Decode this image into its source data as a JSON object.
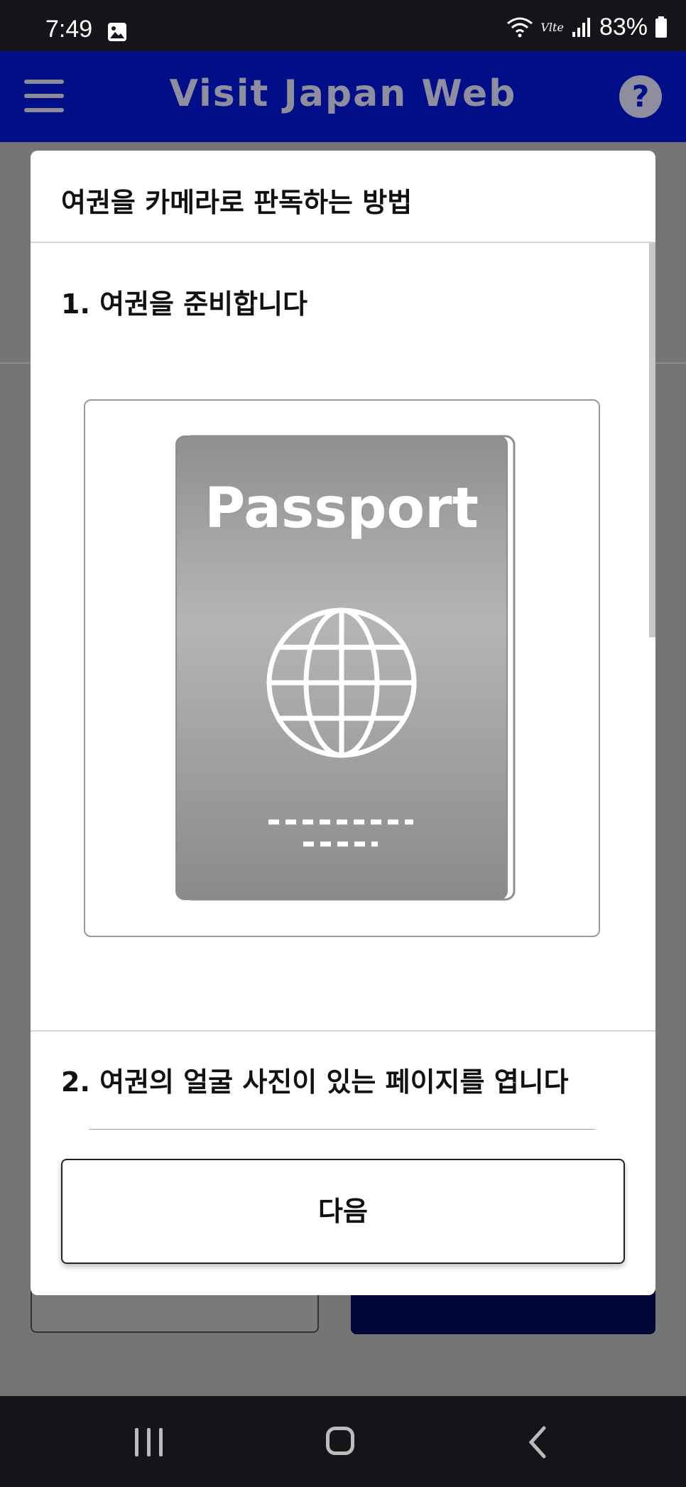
{
  "status_bar": {
    "time": "7:49",
    "battery": "83%",
    "network": "Vlte"
  },
  "app_bar": {
    "title": "Visit Japan Web",
    "help": "?"
  },
  "modal": {
    "title": "여권을 카메라로 판독하는 방법",
    "steps": [
      {
        "label": "1. 여권을 준비합니다",
        "cover_text": "Passport"
      },
      {
        "label": "2. 여권의 얼굴 사진이 있는 페이지를 엽니다"
      }
    ],
    "next_button": "다음"
  },
  "colors": {
    "app_bar": "#000f87",
    "overlay": "#757575",
    "passport": "#9a9a9a",
    "bg_button": "#000636"
  },
  "icons": [
    "gallery-icon",
    "wifi-icon",
    "signal-icon",
    "battery-icon",
    "hamburger-icon",
    "help-icon",
    "globe-icon",
    "recent-apps-icon",
    "home-icon",
    "back-icon"
  ]
}
